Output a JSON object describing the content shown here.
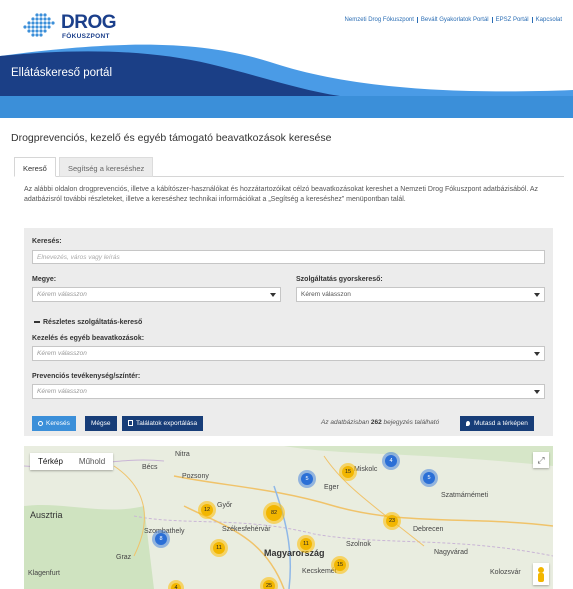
{
  "header": {
    "logo_word": "DROG",
    "logo_sub": "FÓKUSZPONT",
    "top_links": [
      "Nemzeti Drog Fókuszpont",
      "Bevált Gyakorlatok Portál",
      "EPSZ Portál",
      "Kapcsolat"
    ],
    "portal_title": "Ellátáskereső portál"
  },
  "page": {
    "heading": "Drogprevenciós, kezelő és egyéb támogató beavatkozások keresése",
    "tabs": [
      "Kereső",
      "Segítség a kereséshez"
    ],
    "intro": "Az alábbi oldalon drogprevenciós, illetve a kábítószer-használókat és hozzátartozóikat célzó beavatkozásokat kereshet a Nemzeti Drog Fókuszpont adatbázisából. Az adatbázisról további részleteket, illetve a kereséshez technikai információkat a „Segítség a kereséshez” menüpontban talál."
  },
  "search": {
    "query_label": "Keresés:",
    "query_placeholder": "Elnevezés, város vagy leírás",
    "county_label": "Megye:",
    "county_value": "Kérem válasszon",
    "quick_label": "Szolgáltatás gyorskereső:",
    "quick_value": "Kérem válasszon",
    "detail_toggle": "Részletes szolgáltatás-kereső",
    "treatment_label": "Kezelés és egyéb beavatkozások:",
    "treatment_value": "Kérem válasszon",
    "prevention_label": "Prevenciós tevékenység/színtér:",
    "prevention_value": "Kérem válasszon"
  },
  "actions": {
    "search_button": "Keresés",
    "clear_button": "Mégse",
    "export_button": "Találatok exportálása",
    "result_prefix": "Az adatbázisban",
    "result_count": "262",
    "result_suffix": "bejegyzés található",
    "map_button": "Mutasd a térképen"
  },
  "map": {
    "view_map": "Térkép",
    "view_satellite": "Műhold",
    "places": [
      "Nitra",
      "Bécs",
      "Pozsony",
      "Ausztria",
      "Szombathely",
      "Győr",
      "Székesfehérvár",
      "Magyarország",
      "Klagenfurt",
      "Graz",
      "Debrecen",
      "Szatmárnémeti",
      "Nagyvárad",
      "Kolozsvár",
      "Miskolc",
      "Eger",
      "Szolnok",
      "Kecskemét"
    ],
    "clusters": [
      "5",
      "15",
      "4",
      "5",
      "12",
      "82",
      "23",
      "8",
      "11",
      "11",
      "15",
      "25",
      "4"
    ],
    "cluster_colors": {
      "yellow": "#f2b600",
      "blue": "#2b6fd6"
    }
  },
  "colors": {
    "brand_dark": "#173d78",
    "brand_light": "#3b8fd9"
  }
}
